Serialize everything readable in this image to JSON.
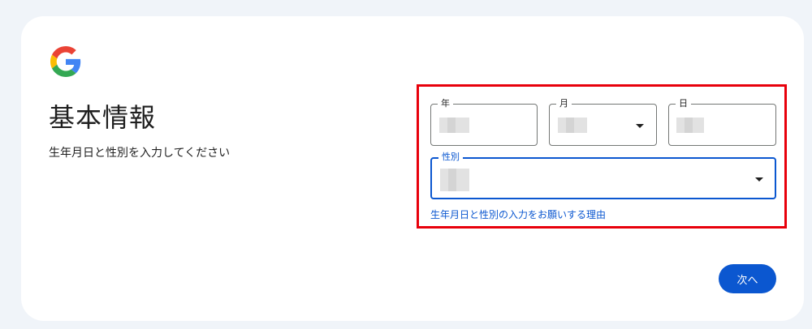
{
  "header": {
    "logo_icon": "google-g-logo",
    "title": "基本情報",
    "subtitle": "生年月日と性別を入力してください"
  },
  "form": {
    "year_label": "年",
    "month_label": "月",
    "day_label": "日",
    "gender_label": "性別",
    "reason_link": "生年月日と性別の入力をお願いする理由"
  },
  "actions": {
    "next_label": "次へ"
  },
  "colors": {
    "accent": "#0b57d0",
    "highlight": "#e8000b",
    "background": "#f0f4f9"
  }
}
